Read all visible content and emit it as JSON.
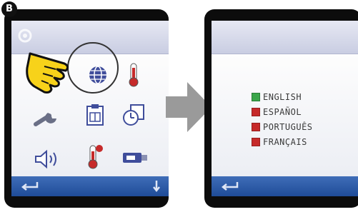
{
  "step_badge": "B",
  "left_screen": {
    "icons": [
      {
        "name": "language-icon",
        "row": 0,
        "col": 1
      },
      {
        "name": "thermometer-icon",
        "row": 0,
        "col": 2
      },
      {
        "name": "wrench-icon",
        "row": 1,
        "col": 0
      },
      {
        "name": "clipboard-icon",
        "row": 1,
        "col": 1
      },
      {
        "name": "clock-calendar-icon",
        "row": 1,
        "col": 2
      },
      {
        "name": "speaker-icon",
        "row": 2,
        "col": 0
      },
      {
        "name": "thermometer-alert-icon",
        "row": 2,
        "col": 1
      },
      {
        "name": "usb-icon",
        "row": 2,
        "col": 2
      }
    ]
  },
  "right_screen": {
    "languages": [
      {
        "label": "ENGLISH",
        "selected": true
      },
      {
        "label": "ESPAÑOL",
        "selected": false
      },
      {
        "label": "PORTUGUÊS",
        "selected": false
      },
      {
        "label": "FRANÇAIS",
        "selected": false
      }
    ]
  },
  "colors": {
    "selected": "#3aa64a",
    "unselected": "#c62a2a",
    "footer": "#2a5aa8",
    "hand": "#f7d21a"
  }
}
